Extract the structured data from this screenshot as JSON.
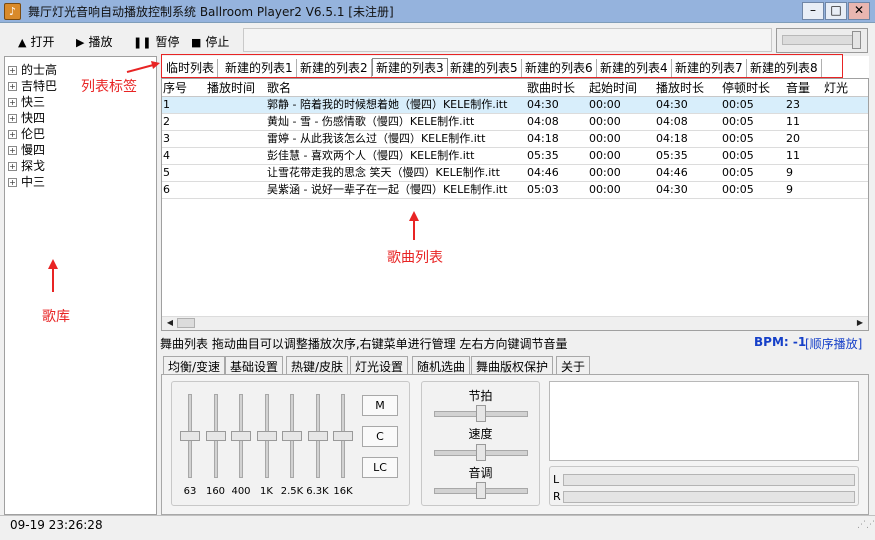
{
  "window": {
    "title": "舞厅灯光音响自动播放控制系统 Ballroom Player2 V6.5.1 [未注册]",
    "app_icon": "person-dancer-icon"
  },
  "toolbar": {
    "open": "打开",
    "play": "播放",
    "pause": "暂停",
    "stop": "停止"
  },
  "library": {
    "items": [
      "的士高",
      "吉特巴",
      "快三",
      "快四",
      "伦巴",
      "慢四",
      "探戈",
      "中三"
    ]
  },
  "annotations": {
    "tabs_label": "列表标签",
    "library_label": "歌库",
    "songlist_label": "歌曲列表"
  },
  "playlist_tabs": [
    "临时列表",
    "新建的列表1",
    "新建的列表2",
    "新建的列表3",
    "新建的列表5",
    "新建的列表6",
    "新建的列表4",
    "新建的列表7",
    "新建的列表8"
  ],
  "active_tab_index": 3,
  "columns": [
    "序号",
    "播放时间",
    "歌名",
    "歌曲时长",
    "起始时间",
    "播放时长",
    "停顿时长",
    "音量",
    "灯光"
  ],
  "songs": [
    {
      "no": "1",
      "playtime": "",
      "name": "郭静 - 陪着我的时候想着她（慢四）KELE制作.itt",
      "duration": "04:30",
      "start": "00:00",
      "playlen": "04:30",
      "pause": "00:05",
      "volume": "23",
      "light": ""
    },
    {
      "no": "2",
      "playtime": "",
      "name": "黄灿 - 雪 - 伤感情歌（慢四）KELE制作.itt",
      "duration": "04:08",
      "start": "00:00",
      "playlen": "04:08",
      "pause": "00:05",
      "volume": "11",
      "light": ""
    },
    {
      "no": "3",
      "playtime": "",
      "name": "雷婷 - 从此我该怎么过（慢四）KELE制作.itt",
      "duration": "04:18",
      "start": "00:00",
      "playlen": "04:18",
      "pause": "00:05",
      "volume": "20",
      "light": ""
    },
    {
      "no": "4",
      "playtime": "",
      "name": "彭佳慧 - 喜欢两个人（慢四）KELE制作.itt",
      "duration": "05:35",
      "start": "00:00",
      "playlen": "05:35",
      "pause": "00:05",
      "volume": "11",
      "light": ""
    },
    {
      "no": "5",
      "playtime": "",
      "name": "让雪花带走我的思念 笑天（慢四）KELE制作.itt",
      "duration": "04:46",
      "start": "00:00",
      "playlen": "04:46",
      "pause": "00:05",
      "volume": "9",
      "light": ""
    },
    {
      "no": "6",
      "playtime": "",
      "name": "吴紫涵 - 说好一辈子在一起（慢四）KELE制作.itt",
      "duration": "05:03",
      "start": "00:00",
      "playlen": "04:30",
      "pause": "00:05",
      "volume": "9",
      "light": ""
    }
  ],
  "status": {
    "hint": "舞曲列表 拖动曲目可以调整播放次序,右键菜单进行管理 左右方向键调节音量",
    "bpm": "BPM: -1",
    "mode": "[顺序播放]"
  },
  "bottom_tabs": [
    "均衡/变速",
    "基础设置",
    "热键/皮肤",
    "灯光设置",
    "随机选曲",
    "舞曲版权保护",
    "关于"
  ],
  "eq": {
    "bands": [
      "63",
      "160",
      "400",
      "1K",
      "2.5K",
      "6.3K",
      "16K"
    ],
    "buttons": [
      "M",
      "C",
      "LC"
    ]
  },
  "controls": {
    "beat": "节拍",
    "speed": "速度",
    "pitch": "音调"
  },
  "meters": {
    "left": "L",
    "right": "R"
  },
  "statusbar": {
    "clock": "09-19 23:26:28"
  },
  "colors": {
    "titlebar": "#95b3dd",
    "annotation_red": "#e82424",
    "selected_row": "#d8eefb",
    "bpm_blue": "#1640c8"
  }
}
